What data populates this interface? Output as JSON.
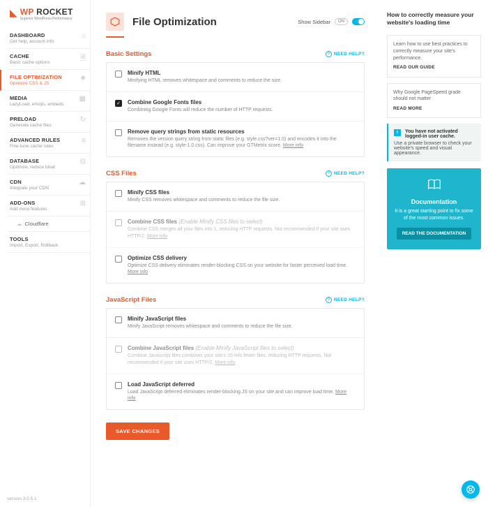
{
  "logo": {
    "brand1": "WP",
    "brand2": "ROCKET",
    "tagline": "Superior WordPress Performance"
  },
  "nav": [
    {
      "title": "DASHBOARD",
      "sub": "Get help, account info"
    },
    {
      "title": "CACHE",
      "sub": "Basic cache options"
    },
    {
      "title": "FILE OPTIMIZATION",
      "sub": "Optimize CSS & JS"
    },
    {
      "title": "MEDIA",
      "sub": "LazyLoad, emojis, embeds"
    },
    {
      "title": "PRELOAD",
      "sub": "Generate cache files"
    },
    {
      "title": "ADVANCED RULES",
      "sub": "Fine-tune cache rules"
    },
    {
      "title": "DATABASE",
      "sub": "Optimize, reduce bloat"
    },
    {
      "title": "CDN",
      "sub": "Integrate your CDN"
    },
    {
      "title": "ADD-ONS",
      "sub": "Add more features"
    },
    {
      "title": "TOOLS",
      "sub": "Import, Export, Rollback"
    }
  ],
  "cloudflare": "Cloudflare",
  "version": "version 3.0.5.1",
  "page": {
    "title": "File Optimization",
    "show_sidebar": "Show Sidebar",
    "on": "ON"
  },
  "help": "NEED HELP?",
  "sections": {
    "basic": {
      "title": "Basic Settings"
    },
    "css": {
      "title": "CSS Files"
    },
    "js": {
      "title": "JavaScript Files"
    }
  },
  "opts": {
    "minify_html": {
      "label": "Minify HTML",
      "desc": "Minifying HTML removes whitespace and comments to reduce the size."
    },
    "combine_fonts": {
      "label": "Combine Google Fonts files",
      "desc": "Combining Google Fonts will reduce the number of HTTP requests."
    },
    "query_strings": {
      "label": "Remove query strings from static resources",
      "desc": "Removes the version query string from static files (e.g. style.css?ver=1.0) and encodes it into the filename instead (e.g. style-1.0.css). Can improve your GTMetrix score. ",
      "more": "More info"
    },
    "minify_css": {
      "label": "Minify CSS files",
      "desc": "Minify CSS removes whitespace and comments to reduce the file size."
    },
    "combine_css": {
      "label": "Combine CSS files",
      "hint": " (Enable Minify CSS files to select)",
      "desc": "Combine CSS merges all your files into 1, reducing HTTP requests. Not recommended if your site uses HTTP/2. ",
      "more": "More info"
    },
    "opt_css": {
      "label": "Optimize CSS delivery",
      "desc": "Optimize CSS delivery eliminates render-blocking CSS on your website for faster perceived load time. ",
      "more": "More info"
    },
    "minify_js": {
      "label": "Minify JavaScript files",
      "desc": "Minify JavaScript removes whitespace and comments to reduce the file size."
    },
    "combine_js": {
      "label": "Combine JavaScript files",
      "hint": " (Enable Minify JavaScript files to select)",
      "desc": "Combine Javascript files combines your site's JS info fewer files, reducing HTTP requests. Not recommended if your site uses HTTP/2. ",
      "more": "More info"
    },
    "defer_js": {
      "label": "Load JavaScript deferred",
      "desc": "Load JavaScript deferred eliminates render-blocking JS on your site and can improve load time. ",
      "more": "More info"
    }
  },
  "save": "SAVE CHANGES",
  "right": {
    "title": "How to correctly measure your website's loading time",
    "card1": {
      "text": "Learn how to use best practices to correctly measure your site's performance.",
      "link": "READ OUR GUIDE"
    },
    "card2": {
      "text": "Why Google PageSpeed grade should not matter",
      "link": "READ MORE"
    },
    "alert": {
      "title": "You have not activated logged-in user cache.",
      "text": "Use a private browser to check your website's speed and visual appearance."
    },
    "doc": {
      "title": "Documentation",
      "desc": "It is a great starting point to fix some of the most common issues.",
      "btn": "READ THE DOCUMENTATION"
    }
  }
}
